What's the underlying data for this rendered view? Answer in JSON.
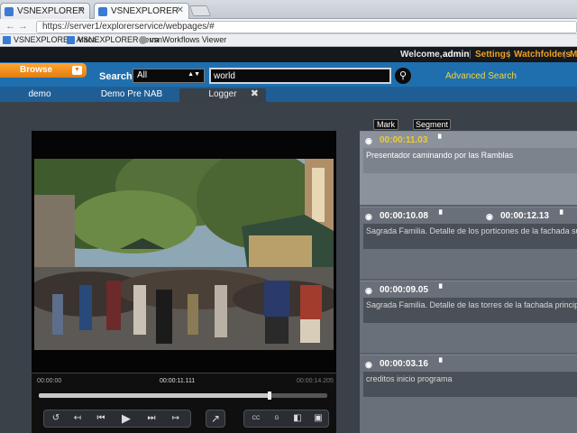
{
  "browser": {
    "tabs": [
      {
        "label": "VSNEXPLORER"
      },
      {
        "label": "VSNEXPLORER"
      }
    ],
    "url": "https://server1/explorerservice/webpages/#",
    "bookmarks": [
      {
        "label": "VSNEXPLORER Alaca"
      },
      {
        "label": "VSNEXPLORER Terra"
      },
      {
        "label": "vsnWorkflows Viewer"
      }
    ]
  },
  "header": {
    "welcome": "Welcome,",
    "user": "admin",
    "links": [
      "Settings",
      "Watchfolders",
      "M"
    ]
  },
  "toolbar": {
    "browse_label": "Browse",
    "search_label": "Search",
    "scope": "All",
    "query": "world",
    "advanced": "Advanced Search"
  },
  "tabs": [
    {
      "label": "demo"
    },
    {
      "label": "Demo Pre NAB"
    },
    {
      "label": "Logger"
    }
  ],
  "player": {
    "tc_start": "00:00:00",
    "tc_current": "00:00:11.111",
    "tc_end": "00:00:14.205",
    "progress": 0.8,
    "buttons": [
      "↺",
      "↤",
      "⏮",
      "▶",
      "⏭",
      "↦",
      "↗",
      "CC",
      "G",
      "◧",
      "▣"
    ]
  },
  "logger": {
    "mark_label": "Mark",
    "segment_label": "Segment",
    "entries": [
      {
        "tc_in": "00:00:11.03",
        "tc_out": "",
        "desc": "Presentador caminando por las Ramblas",
        "selected": true
      },
      {
        "tc_in": "00:00:10.08",
        "tc_out": "00:00:12.13",
        "desc": "Sagrada Familia. Detalle de los porticones de la fachada su",
        "selected": false
      },
      {
        "tc_in": "00:00:09.05",
        "tc_out": "",
        "desc": "Sagrada Familia. Detalle de las torres de la fachada princip",
        "selected": false
      },
      {
        "tc_in": "00:00:03.16",
        "tc_out": "",
        "desc": "creditos inicio programa",
        "selected": false
      }
    ]
  },
  "colors": {
    "accent": "#f0a020",
    "toolbar": "#1f6fae",
    "timecode": "#f1cc2a"
  }
}
